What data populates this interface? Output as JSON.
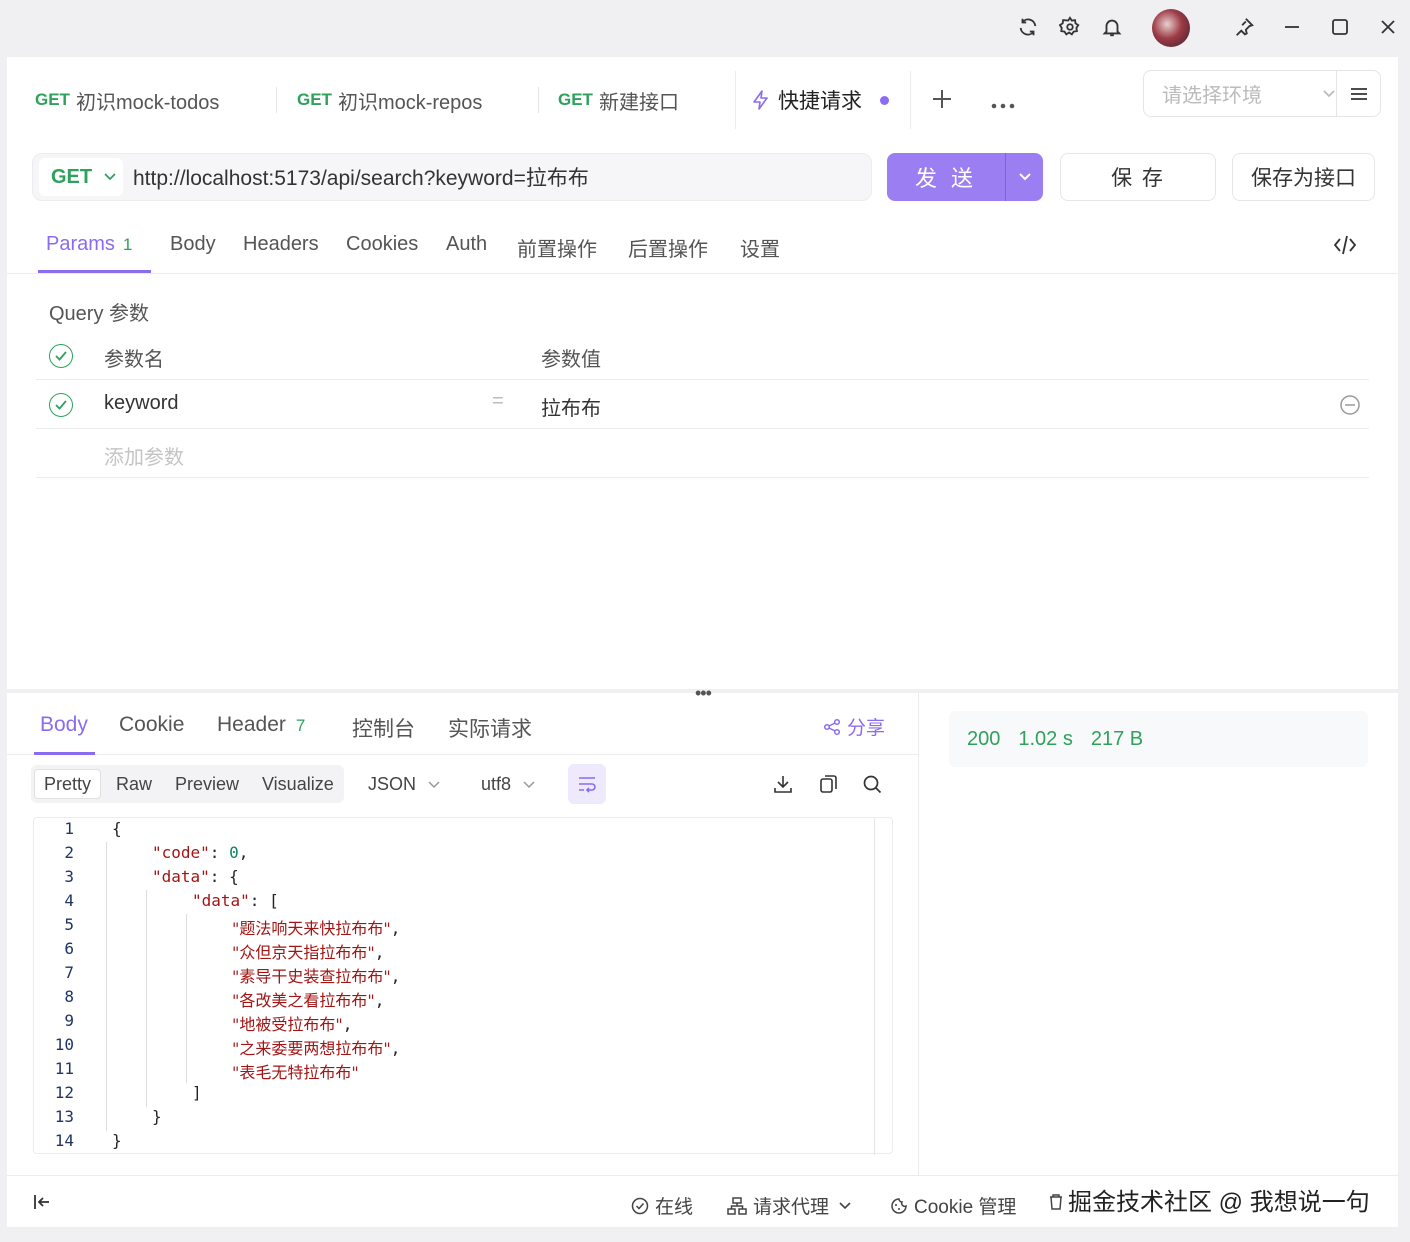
{
  "titlebar": {
    "icons": [
      "refresh-icon",
      "gear-icon",
      "bell-icon",
      "avatar",
      "pin-icon",
      "minimize-icon",
      "maximize-icon",
      "close-icon"
    ]
  },
  "tabs": [
    {
      "method": "GET",
      "label": "初识mock-todos"
    },
    {
      "method": "GET",
      "label": "初识mock-repos"
    },
    {
      "method": "GET",
      "label": "新建接口"
    }
  ],
  "active_tab": {
    "label": "快捷请求"
  },
  "env": {
    "placeholder": "请选择环境"
  },
  "request": {
    "method": "GET",
    "url": "http://localhost:5173/api/search?keyword=拉布布",
    "send_label": "发 送",
    "save_label": "保 存",
    "save_as_label": "保存为接口"
  },
  "param_tabs": [
    {
      "label": "Params",
      "badge": "1"
    },
    {
      "label": "Body"
    },
    {
      "label": "Headers"
    },
    {
      "label": "Cookies"
    },
    {
      "label": "Auth"
    },
    {
      "label": "前置操作"
    },
    {
      "label": "后置操作"
    },
    {
      "label": "设置"
    }
  ],
  "query": {
    "title": "Query 参数",
    "header_name": "参数名",
    "header_value": "参数值",
    "row": {
      "name": "keyword",
      "eq": "=",
      "value": "拉布布"
    },
    "add_placeholder": "添加参数"
  },
  "response_tabs": [
    {
      "label": "Body"
    },
    {
      "label": "Cookie"
    },
    {
      "label": "Header",
      "badge": "7"
    },
    {
      "label": "控制台"
    },
    {
      "label": "实际请求"
    }
  ],
  "share_label": "分享",
  "status": {
    "code": "200",
    "time": "1.02 s",
    "size": "217 B"
  },
  "format_tabs": [
    "Pretty",
    "Raw",
    "Preview",
    "Visualize"
  ],
  "format_select": "JSON",
  "encoding_select": "utf8",
  "code_lines": [
    {
      "n": "1",
      "indent": 0,
      "parts": [
        [
          "p",
          "{"
        ]
      ]
    },
    {
      "n": "2",
      "indent": 1,
      "parts": [
        [
          "k",
          "\"code\""
        ],
        [
          "p",
          ": "
        ],
        [
          "n",
          "0"
        ],
        [
          "p",
          ","
        ]
      ]
    },
    {
      "n": "3",
      "indent": 1,
      "parts": [
        [
          "k",
          "\"data\""
        ],
        [
          "p",
          ": {"
        ]
      ]
    },
    {
      "n": "4",
      "indent": 2,
      "parts": [
        [
          "k",
          "\"data\""
        ],
        [
          "p",
          ": ["
        ]
      ]
    },
    {
      "n": "5",
      "indent": 3,
      "parts": [
        [
          "s",
          "\"题法响天来快拉布布\""
        ],
        [
          "p",
          ","
        ]
      ]
    },
    {
      "n": "6",
      "indent": 3,
      "parts": [
        [
          "s",
          "\"众但京天指拉布布\""
        ],
        [
          "p",
          ","
        ]
      ]
    },
    {
      "n": "7",
      "indent": 3,
      "parts": [
        [
          "s",
          "\"素导干史装查拉布布\""
        ],
        [
          "p",
          ","
        ]
      ]
    },
    {
      "n": "8",
      "indent": 3,
      "parts": [
        [
          "s",
          "\"各改美之看拉布布\""
        ],
        [
          "p",
          ","
        ]
      ]
    },
    {
      "n": "9",
      "indent": 3,
      "parts": [
        [
          "s",
          "\"地被受拉布布\""
        ],
        [
          "p",
          ","
        ]
      ]
    },
    {
      "n": "10",
      "indent": 3,
      "parts": [
        [
          "s",
          "\"之来委要两想拉布布\""
        ],
        [
          "p",
          ","
        ]
      ]
    },
    {
      "n": "11",
      "indent": 3,
      "parts": [
        [
          "s",
          "\"表毛无特拉布布\""
        ]
      ]
    },
    {
      "n": "12",
      "indent": 2,
      "parts": [
        [
          "p",
          "]"
        ]
      ]
    },
    {
      "n": "13",
      "indent": 1,
      "parts": [
        [
          "p",
          "}"
        ]
      ]
    },
    {
      "n": "14",
      "indent": 0,
      "parts": [
        [
          "p",
          "}"
        ]
      ]
    }
  ],
  "bottom": {
    "online": "在线",
    "proxy": "请求代理",
    "cookie": "Cookie 管理",
    "watermark": "掘金技术社区 @ 我想说一句"
  }
}
